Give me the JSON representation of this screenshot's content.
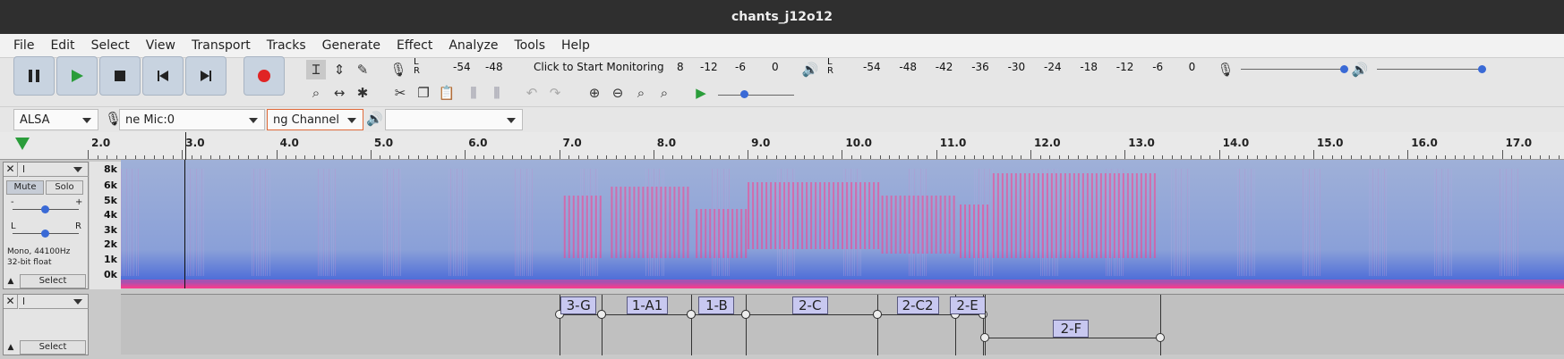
{
  "window": {
    "title": "chants_j12o12"
  },
  "menu": [
    "File",
    "Edit",
    "Select",
    "View",
    "Transport",
    "Tracks",
    "Generate",
    "Effect",
    "Analyze",
    "Tools",
    "Help"
  ],
  "meters": {
    "record_scale": [
      "-54",
      "-48",
      "Click to Start Monitoring",
      "8",
      "-12",
      "-6",
      "0"
    ],
    "playback_scale": [
      "-54",
      "-48",
      "-42",
      "-36",
      "-30",
      "-24",
      "-18",
      "-12",
      "-6",
      "0"
    ],
    "lr": "L\nR"
  },
  "device": {
    "host": "ALSA",
    "recording_device": "ne Mic:0",
    "channels": "ng Channel",
    "playback_device": ""
  },
  "ruler": {
    "ticks": [
      "2.0",
      "3.0",
      "4.0",
      "5.0",
      "6.0",
      "7.0",
      "8.0",
      "9.0",
      "10.0",
      "11.0",
      "12.0",
      "13.0",
      "14.0",
      "15.0",
      "16.0",
      "17.0"
    ]
  },
  "audio_track": {
    "name": "l",
    "mute": "Mute",
    "solo": "Solo",
    "gain_minus": "-",
    "gain_plus": "+",
    "pan_l": "L",
    "pan_r": "R",
    "format": "Mono, 44100Hz",
    "bitdepth": "32-bit float",
    "select": "Select",
    "freq_labels": [
      "8k",
      "6k",
      "5k",
      "4k",
      "3k",
      "2k",
      "1k",
      "0k"
    ]
  },
  "label_track": {
    "name": "l",
    "select": "Select",
    "labels": [
      {
        "text": "3-G",
        "start": 7.0,
        "end": 7.45
      },
      {
        "text": "1-A1",
        "start": 7.45,
        "end": 8.4
      },
      {
        "text": "1-B",
        "start": 8.4,
        "end": 8.98
      },
      {
        "text": "2-C",
        "start": 8.98,
        "end": 10.38
      },
      {
        "text": "2-C2",
        "start": 10.38,
        "end": 11.2
      },
      {
        "text": "2-E",
        "start": 11.2,
        "end": 11.5
      },
      {
        "text": "2-F",
        "start": 11.52,
        "end": 13.38
      }
    ]
  },
  "colors": {
    "spectro_low": "#8aa0d8",
    "spectro_high": "#ff3a8a",
    "label_fill": "#c8c8f0"
  }
}
